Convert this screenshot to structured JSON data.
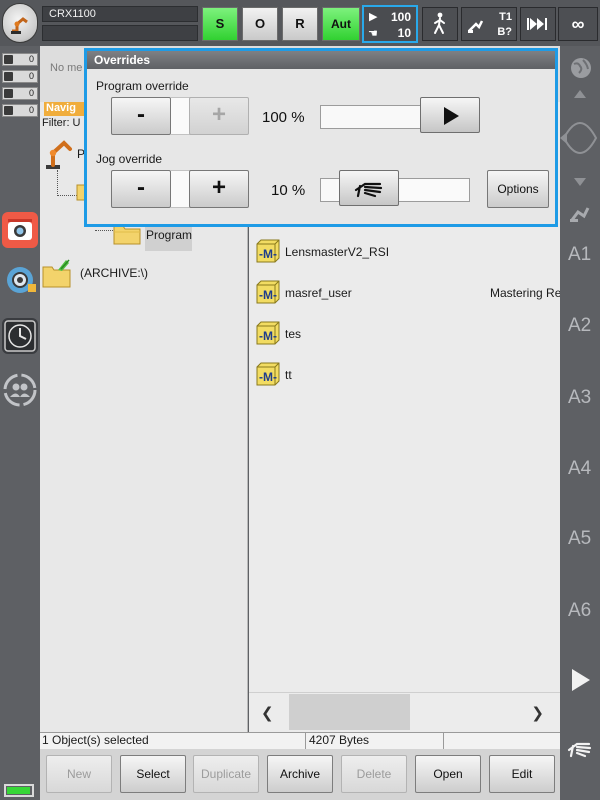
{
  "topbar": {
    "robot_name": "CRX1100",
    "status_s": "S",
    "status_o": "O",
    "status_r": "R",
    "mode": "Aut",
    "program_override": "100",
    "jog_override": "10",
    "tool_label_top": "T1",
    "tool_label_bottom": "B?",
    "infinity_label": "∞"
  },
  "leftstrip": {
    "axis_rows": [
      {
        "value": "0"
      },
      {
        "value": "0"
      },
      {
        "value": "0"
      },
      {
        "value": "0"
      }
    ]
  },
  "navigator": {
    "message": "No me",
    "tab_label": "Navig",
    "filter_label": "Filter: U",
    "root_label": "P",
    "program_label": "Program",
    "archive_label": "(ARCHIVE:\\)"
  },
  "files": [
    {
      "name": "LensmasterV2_RSI",
      "comment": ""
    },
    {
      "name": "masref_user",
      "comment": "Mastering Re"
    },
    {
      "name": "tes",
      "comment": ""
    },
    {
      "name": "tt",
      "comment": ""
    }
  ],
  "statusbar": {
    "selected": "1 Object(s) selected",
    "size": "4207 Bytes"
  },
  "softkeys": {
    "new": "New",
    "select": "Select",
    "duplicate": "Duplicate",
    "archive": "Archive",
    "delete": "Delete",
    "open": "Open",
    "edit": "Edit"
  },
  "rightstrip": {
    "axes": [
      "A1",
      "A2",
      "A3",
      "A4",
      "A5",
      "A6"
    ]
  },
  "overrides": {
    "title": "Overrides",
    "program_label": "Program override",
    "program_value": "100 %",
    "program_level": 1.0,
    "minus": "-",
    "plus": "+",
    "jog_label": "Jog override",
    "jog_value": "10 %",
    "jog_level": 0.1,
    "options": "Options"
  }
}
